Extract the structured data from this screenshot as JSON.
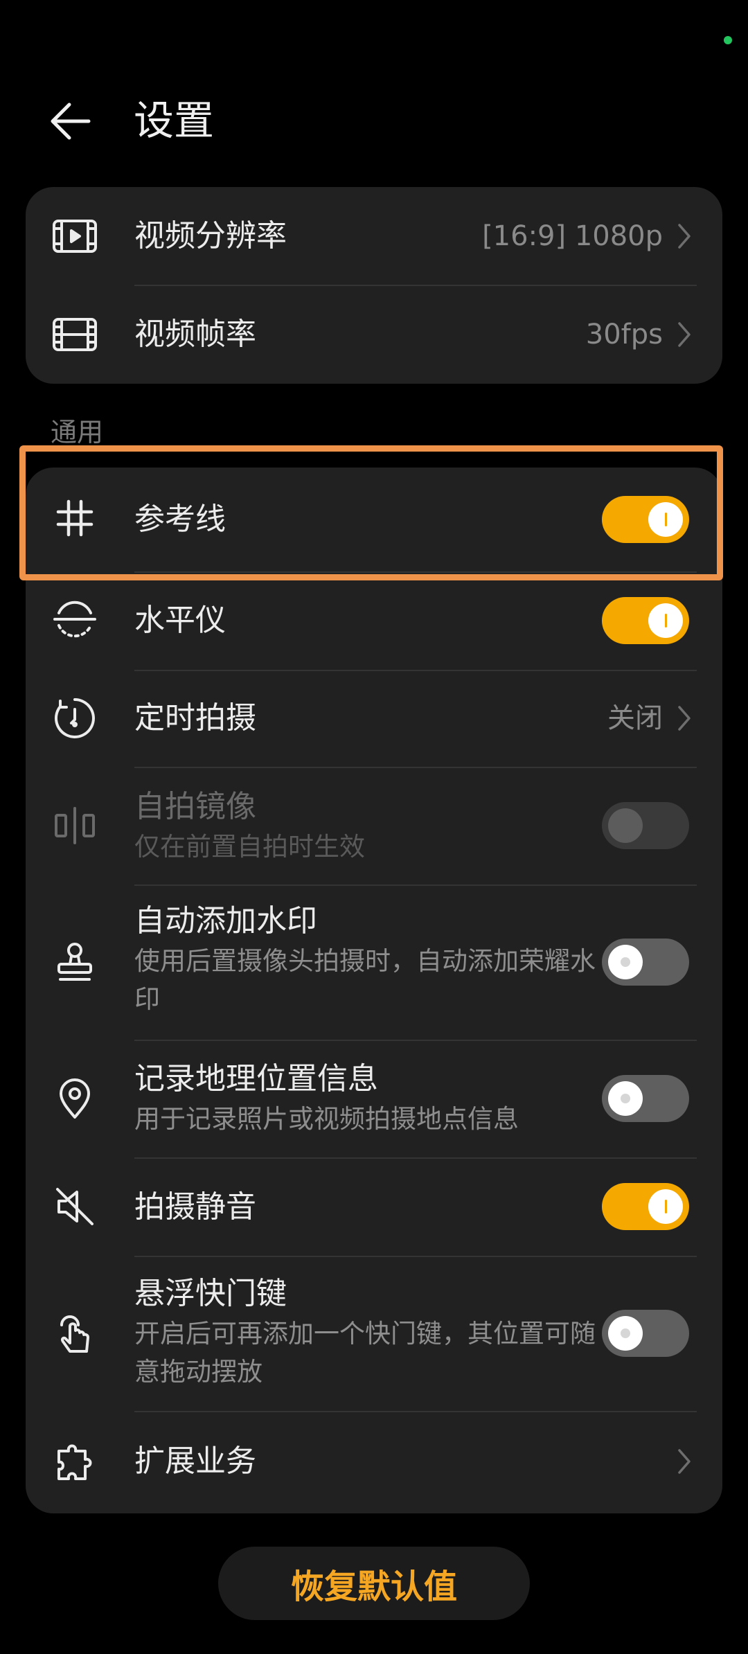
{
  "header": {
    "title": "设置"
  },
  "video": {
    "resolution": {
      "label": "视频分辨率",
      "value": "[16:9] 1080p",
      "icon": "video-resolution-icon"
    },
    "framerate": {
      "label": "视频帧率",
      "value": "30fps",
      "icon": "film-frame-icon"
    }
  },
  "general": {
    "section_label": "通用",
    "gridlines": {
      "label": "参考线",
      "enabled": true,
      "icon": "grid-icon"
    },
    "level": {
      "label": "水平仪",
      "enabled": true,
      "icon": "level-icon"
    },
    "timer": {
      "label": "定时拍摄",
      "value": "关闭",
      "icon": "timer-icon"
    },
    "mirror": {
      "label": "自拍镜像",
      "sub": "仅在前置自拍时生效",
      "enabled": false,
      "disabled": true,
      "icon": "mirror-icon"
    },
    "watermark": {
      "label": "自动添加水印",
      "sub": "使用后置摄像头拍摄时，自动添加荣耀水印",
      "enabled": false,
      "icon": "stamp-icon"
    },
    "location": {
      "label": "记录地理位置信息",
      "sub": "用于记录照片或视频拍摄地点信息",
      "enabled": false,
      "icon": "location-pin-icon"
    },
    "mute": {
      "label": "拍摄静音",
      "enabled": true,
      "icon": "mute-icon"
    },
    "floating_shutter": {
      "label": "悬浮快门键",
      "sub": "开启后可再添加一个快门键，其位置可随意拖动摆放",
      "enabled": false,
      "icon": "touch-hand-icon"
    },
    "extensions": {
      "label": "扩展业务",
      "icon": "puzzle-icon"
    }
  },
  "reset_label": "恢复默认值",
  "colors": {
    "accent": "#f5a800",
    "highlight": "#f0934a",
    "card": "#212121",
    "background": "#000000"
  }
}
